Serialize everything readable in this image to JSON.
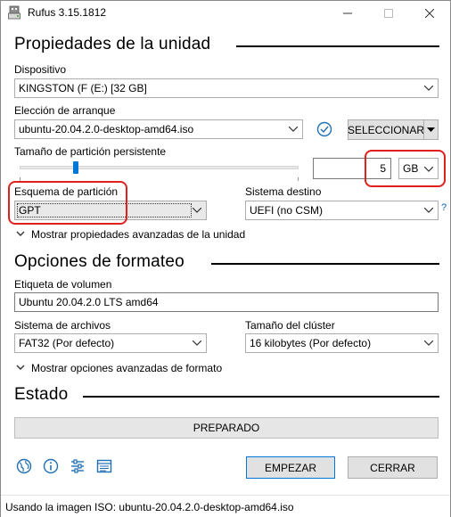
{
  "window": {
    "title": "Rufus 3.15.1812"
  },
  "drive_props": {
    "heading": "Propiedades de la unidad",
    "device_label": "Dispositivo",
    "device_value": "KINGSTON (F (E:) [32 GB]",
    "boot_label": "Elección de arranque",
    "boot_value": "ubuntu-20.04.2.0-desktop-amd64.iso",
    "select_button": "SELECCIONAR",
    "persistent_label": "Tamaño de partición persistente",
    "persistent_size": "5",
    "persistent_unit": "GB",
    "scheme_label": "Esquema de partición",
    "scheme_value": "GPT",
    "target_label": "Sistema destino",
    "target_value": "UEFI (no CSM)",
    "target_help": "?",
    "advanced_toggle": "Mostrar propiedades avanzadas de la unidad"
  },
  "format_opts": {
    "heading": "Opciones de formateo",
    "volume_label": "Etiqueta de volumen",
    "volume_value": "Ubuntu 20.04.2.0 LTS amd64",
    "fs_label": "Sistema de archivos",
    "fs_value": "FAT32 (Por defecto)",
    "cluster_label": "Tamaño del clúster",
    "cluster_value": "16 kilobytes (Por defecto)",
    "advanced_toggle": "Mostrar opciones avanzadas de formato"
  },
  "status": {
    "heading": "Estado",
    "progress_text": "PREPARADO",
    "progress": 0
  },
  "actions": {
    "start": "EMPEZAR",
    "close": "CERRAR"
  },
  "icons": {
    "language": "globe-icon",
    "about": "info-icon",
    "settings": "sliders-icon",
    "log": "log-icon"
  },
  "statusbar": {
    "text": "Usando la imagen ISO: ubuntu-20.04.2.0-desktop-amd64.iso"
  },
  "colors": {
    "highlight": "#e0201c",
    "accent": "#0078d7",
    "icon_blue": "#1e6fb6"
  }
}
